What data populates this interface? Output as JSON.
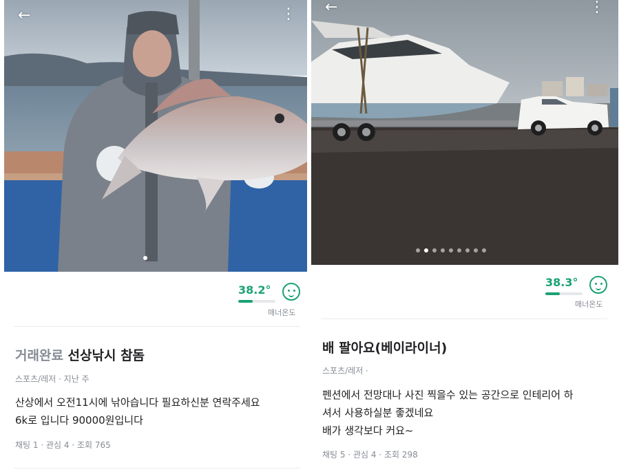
{
  "left": {
    "temperature": {
      "value": "38.2°",
      "level": 0.382,
      "caption": "매너온도"
    },
    "photo_indicator": {
      "count": 1,
      "active": 0
    },
    "title": {
      "status": "거래완료",
      "text": "선상낚시 참돔"
    },
    "meta": "스포츠/레저 · 지난 주",
    "description": [
      "산상에서 오전11시에  낚아습니다 필요하신분 연락주세요",
      "6k로 입니다 90000원입니다"
    ],
    "stats": "채팅 1 · 관심 4 · 조회 765"
  },
  "right": {
    "temperature": {
      "value": "38.3°",
      "level": 0.383,
      "caption": "매너온도"
    },
    "photo_indicator": {
      "count": 9,
      "active": 1
    },
    "title": {
      "text": "배 팔아요(베이라이너)"
    },
    "meta": "스포츠/레저 ·",
    "description": [
      "펜션에서 전망대나 사진 찍을수 있는 공간으로 인테리어 하",
      "셔서 사용하실분 좋겠네요",
      "배가 생각보다 커요~"
    ],
    "stats": "채팅 5 · 관심 4 · 조회 298"
  },
  "icons": {
    "back": "back-arrow-icon",
    "share": "share-icon",
    "more": "more-vertical-icon",
    "manner": "smiley-face-icon"
  },
  "colors": {
    "accent_green": "#1aa174",
    "muted_text": "#868b94",
    "text": "#212124"
  }
}
